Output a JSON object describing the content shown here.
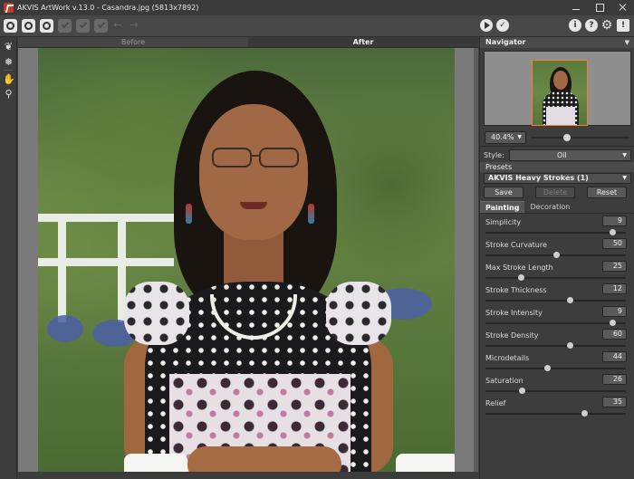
{
  "window": {
    "title": "AKVIS ArtWork v.13.0 - Casandra.jpg (5813x7892)"
  },
  "view_tabs": {
    "before": "Before",
    "after": "After"
  },
  "navigator": {
    "title": "Navigator",
    "zoom_value": "40.4%",
    "zoom_level": 0.36
  },
  "style": {
    "label": "Style:",
    "value": "Oil"
  },
  "presets": {
    "title": "Presets",
    "selected": "AKVIS Heavy Strokes (1)",
    "save_label": "Save",
    "delete_label": "Delete",
    "reset_label": "Reset"
  },
  "param_tabs": {
    "painting": "Painting",
    "decoration": "Decoration"
  },
  "params": [
    {
      "label": "Simplicity",
      "value": "9",
      "fraction": 0.9
    },
    {
      "label": "Stroke Curvature",
      "value": "50",
      "fraction": 0.5
    },
    {
      "label": "Max Stroke Length",
      "value": "25",
      "fraction": 0.25
    },
    {
      "label": "Stroke Thickness",
      "value": "12",
      "fraction": 0.6
    },
    {
      "label": "Stroke Intensity",
      "value": "9",
      "fraction": 0.9
    },
    {
      "label": "Stroke Density",
      "value": "60",
      "fraction": 0.6
    },
    {
      "label": "Microdetails",
      "value": "44",
      "fraction": 0.44
    },
    {
      "label": "Saturation",
      "value": "26",
      "fraction": 0.26
    },
    {
      "label": "Relief",
      "value": "35",
      "fraction": 0.7
    }
  ]
}
